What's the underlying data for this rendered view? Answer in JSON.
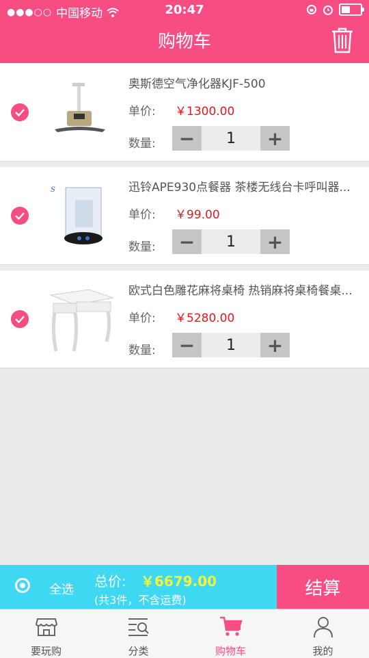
{
  "status_bar": {
    "signal_dots": "●●●○○",
    "carrier": "中国移动",
    "time": "20:47"
  },
  "header": {
    "title": "购物车",
    "trash_icon": "trash-icon"
  },
  "cart": {
    "items": [
      {
        "name": "奥斯德空气净化器KJF-500",
        "price_label": "单价:",
        "price": "￥1300.00",
        "qty_label": "数量:",
        "minus": "−",
        "quantity": "1",
        "plus": "+",
        "selected": true,
        "image_icon": "air-purifier-image"
      },
      {
        "name": "迅铃APE930点餐器 茶楼无线台卡呼叫器...",
        "price_label": "单价:",
        "price": "￥99.00",
        "qty_label": "数量:",
        "minus": "−",
        "quantity": "1",
        "plus": "+",
        "selected": true,
        "image_icon": "pager-image"
      },
      {
        "name": "欧式白色雕花麻将桌椅 热销麻将桌椅餐桌...",
        "price_label": "单价:",
        "price": "￥5280.00",
        "qty_label": "数量:",
        "minus": "−",
        "quantity": "1",
        "plus": "+",
        "selected": true,
        "image_icon": "table-image"
      }
    ]
  },
  "checkout": {
    "select_all_label": "全选",
    "total_label": "总价:",
    "total_value": "￥6679.00",
    "note": "(共3件，不含运费)",
    "pay_label": "结算"
  },
  "tabbar": {
    "tabs": [
      {
        "label": "要玩购",
        "icon": "store-icon",
        "active": false
      },
      {
        "label": "分类",
        "icon": "category-search-icon",
        "active": false
      },
      {
        "label": "购物车",
        "icon": "cart-icon",
        "active": true
      },
      {
        "label": "我的",
        "icon": "profile-icon",
        "active": false
      }
    ]
  },
  "colors": {
    "brand_pink": "#f74d83",
    "checkout_cyan": "#3ed8f2",
    "price_red": "#e8161c",
    "total_yellow": "#f5f53c"
  }
}
